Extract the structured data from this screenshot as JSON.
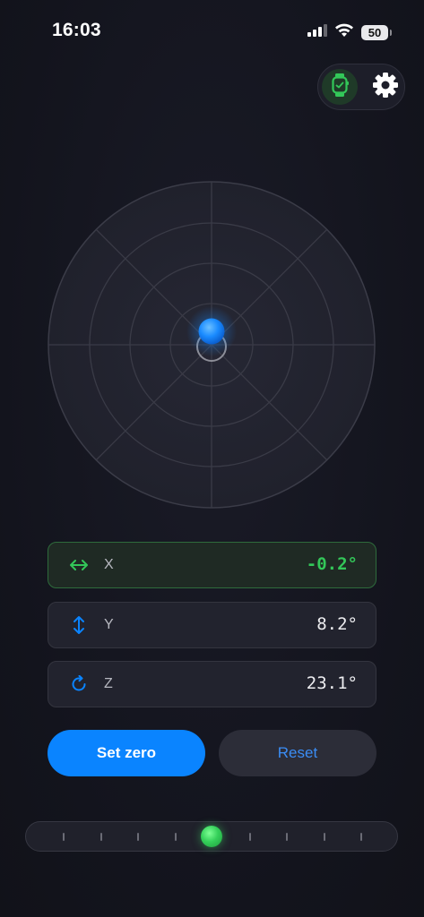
{
  "status_bar": {
    "time": "16:03",
    "battery": "50",
    "icons": [
      "cellular-signal-icon",
      "wifi-icon",
      "battery-icon"
    ]
  },
  "toolbar": {
    "watch_icon": "apple-watch-icon",
    "settings_icon": "gear-icon"
  },
  "colors": {
    "accent_blue": "#0a84ff",
    "accent_green": "#33c759",
    "background": "#13141d"
  },
  "axes": [
    {
      "label": "X",
      "value": "-0.2°",
      "icon": "horizontal-arrows-icon",
      "active": true
    },
    {
      "label": "Y",
      "value": "8.2°",
      "icon": "vertical-arrows-icon",
      "active": false
    },
    {
      "label": "Z",
      "value": "23.1°",
      "icon": "rotate-icon",
      "active": false
    }
  ],
  "buttons": {
    "set_zero": "Set zero",
    "reset": "Reset"
  },
  "slider": {
    "tick_count": 9,
    "position": 0.5
  }
}
